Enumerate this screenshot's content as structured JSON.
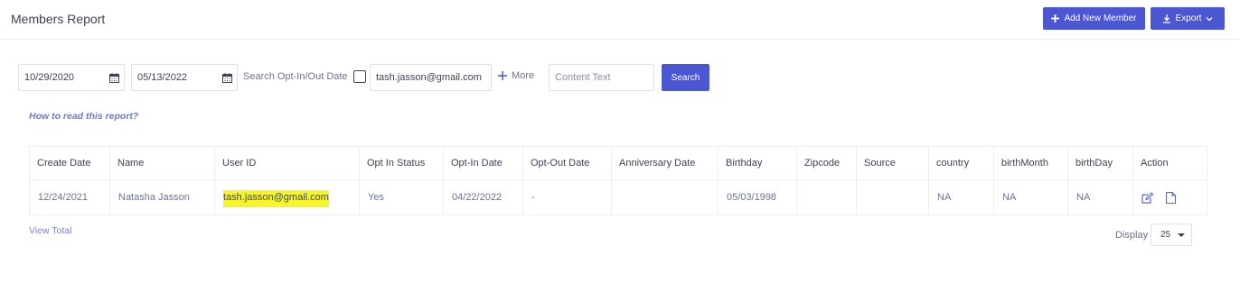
{
  "header": {
    "title": "Members Report",
    "add_member_label": "Add New Member",
    "export_label": "Export"
  },
  "filters": {
    "start_date": "10/29/2020",
    "end_date": "05/13/2022",
    "optin_label": "Search Opt-In/Out Date",
    "optin_checked": false,
    "email_value": "tash.jasson@gmail.com",
    "more_label": "More",
    "content_placeholder": "Content Text",
    "search_label": "Search"
  },
  "help_link": "How to read this report?",
  "table": {
    "columns": [
      "Create Date",
      "Name",
      "User ID",
      "Opt In Status",
      "Opt-In Date",
      "Opt-Out Date",
      "Anniversary Date",
      "Birthday",
      "Zipcode",
      "Source",
      "country",
      "birthMonth",
      "birthDay",
      "Action"
    ],
    "rows": [
      {
        "create_date": "12/24/2021",
        "name": "Natasha Jasson",
        "user_id": "tash.jasson@gmail.com",
        "opt_in_status": "Yes",
        "opt_in_date": "04/22/2022",
        "opt_out_date": "-",
        "anniversary_date": "",
        "birthday": "05/03/1998",
        "zipcode": "",
        "source": "",
        "country": "NA",
        "birth_month": "NA",
        "birth_day": "NA"
      }
    ]
  },
  "footer": {
    "view_total": "View Total",
    "display_label": "Display",
    "page_size": "25"
  },
  "colors": {
    "primary": "#4b56d2",
    "highlight": "#f5f52a",
    "link": "#6c7bc4"
  }
}
